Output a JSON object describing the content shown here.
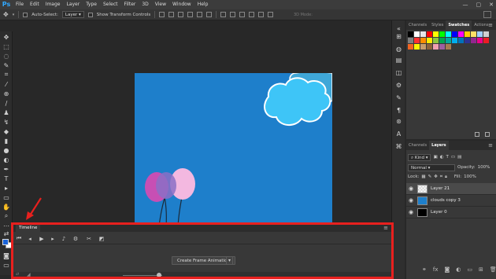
{
  "app": {
    "logo": "Ps"
  },
  "menu": [
    "File",
    "Edit",
    "Image",
    "Layer",
    "Type",
    "Select",
    "Filter",
    "3D",
    "View",
    "Window",
    "Help"
  ],
  "window_controls": [
    "—",
    "▢",
    "✕"
  ],
  "options_bar": {
    "auto_select_label": "Auto-Select:",
    "auto_select_value": "Layer",
    "show_transform_label": "Show Transform Controls",
    "mode_3d_label": "3D Mode:"
  },
  "swatches_panel": {
    "tabs": [
      "Channels",
      "Styles",
      "Swatches",
      "Actions"
    ],
    "active_tab": "Swatches",
    "swatches": [
      "#000000",
      "#ffffff",
      "#e6e6e6",
      "#ff0000",
      "#ffff00",
      "#00ff00",
      "#00ffff",
      "#0000ff",
      "#ff00ff",
      "#ffcc00",
      "#ffe066",
      "#a0d0ff",
      "#d0d0d0",
      "#808080",
      "#ff3030",
      "#ff8c00",
      "#ffeb00",
      "#8cc63f",
      "#00a651",
      "#00a99d",
      "#00aeef",
      "#0072bc",
      "#2e3192",
      "#92278f",
      "#ec008c",
      "#ed1c24",
      "#f26522",
      "#fff200",
      "#c69c6d",
      "#8c6239",
      "#f0a0b0",
      "#9e5fa0",
      "#a67c52"
    ]
  },
  "layers_panel": {
    "tabs": [
      "Channels",
      "Layers"
    ],
    "active_tab": "Layers",
    "kind_filter": "Kind",
    "blend_mode": "Normal",
    "opacity_label": "Opacity:",
    "opacity_value": "100%",
    "lock_label": "Lock:",
    "fill_label": "Fill:",
    "fill_value": "100%",
    "layers": [
      {
        "name": "Layer 21",
        "selected": true,
        "thumb": "transparent"
      },
      {
        "name": "clouds copy 3",
        "selected": false,
        "thumb": "#1e7fcb"
      },
      {
        "name": "Layer 0",
        "selected": false,
        "thumb": "#000000"
      }
    ]
  },
  "timeline": {
    "tab_label": "Timeline",
    "create_button_label": "Create Frame Animation"
  },
  "colors": {
    "foreground": "#1a63d8",
    "background": "#ffffff",
    "canvas": "#1e7fcb",
    "annotation": "#e8201e"
  }
}
